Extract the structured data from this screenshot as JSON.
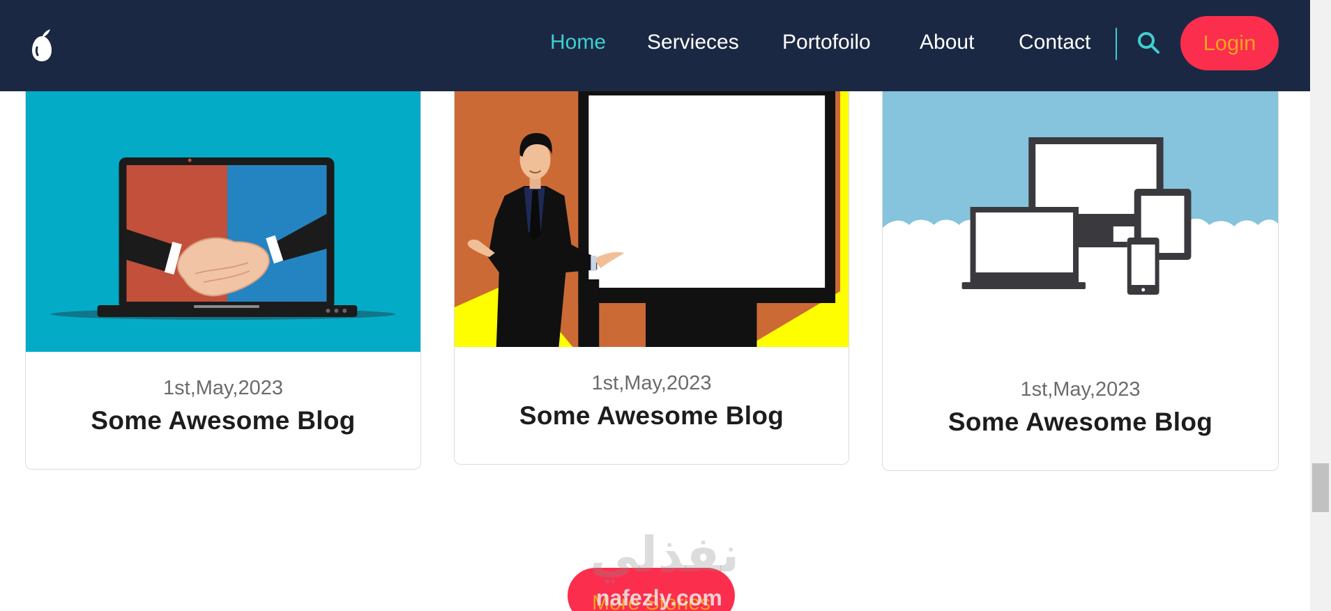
{
  "navbar": {
    "logo_icon": "pear-logo-icon",
    "links": [
      {
        "label": "Home",
        "active": true
      },
      {
        "label": "Servieces",
        "active": false
      },
      {
        "label": "Portofoilo",
        "active": false
      },
      {
        "label": "About",
        "active": false
      },
      {
        "label": "Contact",
        "active": false
      }
    ],
    "search_icon": "search-icon",
    "login_label": "Login"
  },
  "cards": [
    {
      "date": "1st,May,2023",
      "title": "Some Awesome Blog",
      "image_icon": "laptop-handshake-illustration"
    },
    {
      "date": "1st,May,2023",
      "title": "Some Awesome Blog",
      "image_icon": "presenter-whiteboard-illustration"
    },
    {
      "date": "1st,May,2023",
      "title": "Some Awesome Blog",
      "image_icon": "devices-cloud-illustration"
    }
  ],
  "more_stories_label": "More Stories",
  "watermark": {
    "arabic": "نفذلي",
    "url": "nafezly.com"
  },
  "colors": {
    "navbar_bg": "#1b2843",
    "active_link": "#3ecfd0",
    "button_bg": "#fb2e4e",
    "button_text": "#f7a21f"
  }
}
